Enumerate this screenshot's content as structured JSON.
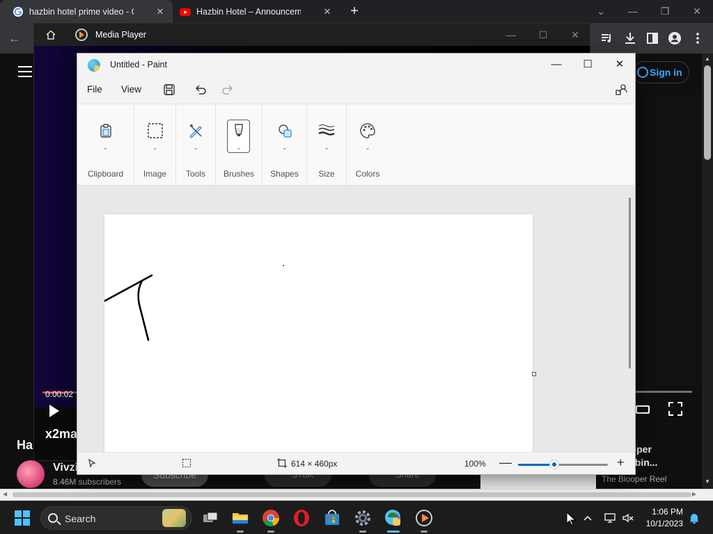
{
  "chrome": {
    "tabs": [
      {
        "title": "hazbin hotel prime video - Goog",
        "favicon": "google-icon"
      },
      {
        "title": "Hazbin Hotel – Announcement |",
        "favicon": "youtube-icon"
      }
    ],
    "window_controls": [
      "chevron-down-icon",
      "minimize-icon",
      "restore-icon",
      "close-icon"
    ]
  },
  "youtube": {
    "sign_in": "Sign in",
    "title_start": "Ha",
    "channel": "Vivzi",
    "subscribers": "8.46M subscribers",
    "subscribe": "Subscribe",
    "likes": "378K",
    "share": "Share",
    "related_title_1": "opper",
    "related_title_2": "azbin...",
    "related_channel": "The Blooper Reel"
  },
  "media_player": {
    "title": "Media Player",
    "time": "0:00:02",
    "file_name": "x2ma"
  },
  "paint": {
    "title": "Untitled - Paint",
    "menu": {
      "file": "File",
      "view": "View"
    },
    "ribbon": [
      {
        "label": "Clipboard",
        "icon": "clipboard-icon"
      },
      {
        "label": "Image",
        "icon": "selection-icon"
      },
      {
        "label": "Tools",
        "icon": "tools-icon"
      },
      {
        "label": "Brushes",
        "icon": "brush-icon",
        "selected": true
      },
      {
        "label": "Shapes",
        "icon": "shapes-icon"
      },
      {
        "label": "Size",
        "icon": "size-icon"
      },
      {
        "label": "Colors",
        "icon": "palette-icon"
      }
    ],
    "status": {
      "canvas_size": "614 × 460px",
      "zoom": "100%",
      "zoom_fraction": 0.4
    }
  },
  "taskbar": {
    "search": "Search",
    "time": "1:06 PM",
    "date": "10/1/2023",
    "accent": "#4cc2ff"
  }
}
